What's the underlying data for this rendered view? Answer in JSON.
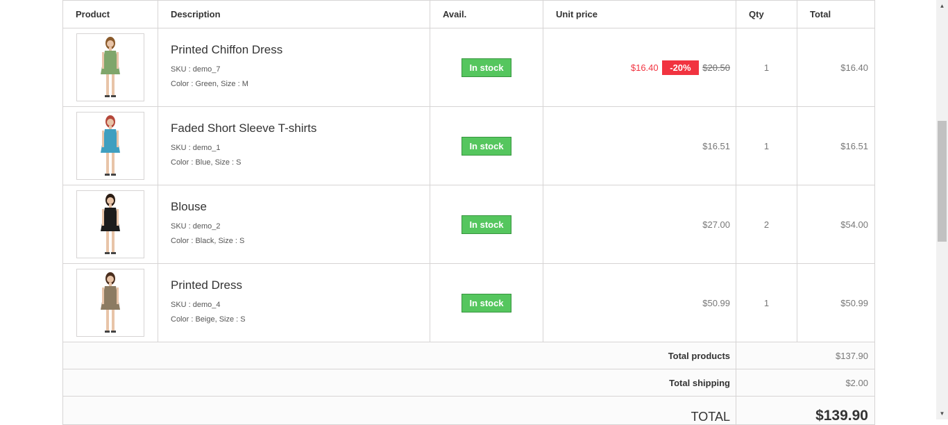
{
  "headers": {
    "product": "Product",
    "description": "Description",
    "avail": "Avail.",
    "unit_price": "Unit price",
    "qty": "Qty",
    "total": "Total"
  },
  "items": [
    {
      "name": "Printed Chiffon Dress",
      "sku": "SKU : demo_7",
      "attrs": "Color : Green, Size : M",
      "availability": "In stock",
      "price_new": "$16.40",
      "discount": "-20%",
      "price_old": "$20.50",
      "qty": "1",
      "total": "$16.40",
      "image_icon": "model-green-dress",
      "colors": {
        "garment": "#7fa66b",
        "hair": "#8a5a2b"
      }
    },
    {
      "name": "Faded Short Sleeve T-shirts",
      "sku": "SKU : demo_1",
      "attrs": "Color : Blue, Size : S",
      "availability": "In stock",
      "price": "$16.51",
      "qty": "1",
      "total": "$16.51",
      "image_icon": "model-blue-tshirt",
      "colors": {
        "garment": "#3f9fc0",
        "hair": "#b5473a"
      }
    },
    {
      "name": "Blouse",
      "sku": "SKU : demo_2",
      "attrs": "Color : Black, Size : S",
      "availability": "In stock",
      "price": "$27.00",
      "qty": "2",
      "total": "$54.00",
      "image_icon": "model-black-blouse",
      "colors": {
        "garment": "#1c1c1c",
        "hair": "#2b1d14"
      }
    },
    {
      "name": "Printed Dress",
      "sku": "SKU : demo_4",
      "attrs": "Color : Beige, Size : S",
      "availability": "In stock",
      "price": "$50.99",
      "qty": "1",
      "total": "$50.99",
      "image_icon": "model-beige-dress",
      "colors": {
        "garment": "#8c7b62",
        "hair": "#4a2e1e"
      }
    }
  ],
  "summary": {
    "total_products_label": "Total products",
    "total_products": "$137.90",
    "total_shipping_label": "Total shipping",
    "total_shipping": "$2.00",
    "grand_total_label": "TOTAL",
    "grand_total": "$139.90"
  },
  "theme": {
    "in_stock_green": "#55c65e",
    "discount_red": "#f13340",
    "border": "#d6d4d4"
  }
}
